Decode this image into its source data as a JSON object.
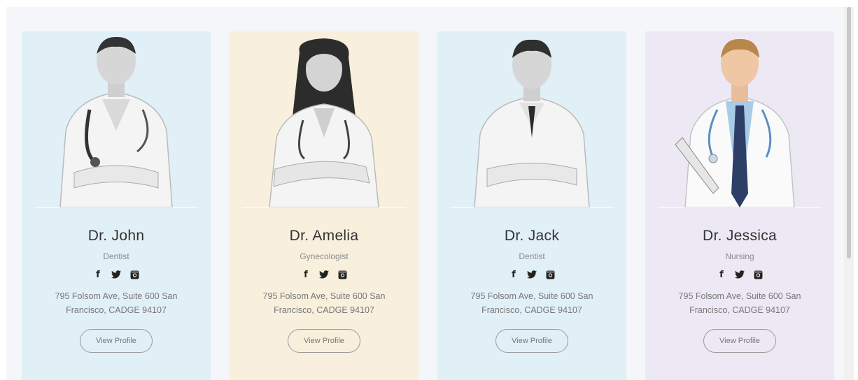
{
  "doctors": [
    {
      "name": "Dr. John",
      "role": "Dentist",
      "address": "795 Folsom Ave, Suite 600 San Francisco, CADGE 94107",
      "button": "View Profile",
      "card_color": "#e1eff7",
      "photo_style": "grayscale"
    },
    {
      "name": "Dr. Amelia",
      "role": "Gynecologist",
      "address": "795 Folsom Ave, Suite 600 San Francisco, CADGE 94107",
      "button": "View Profile",
      "card_color": "#f8f0dc",
      "photo_style": "grayscale"
    },
    {
      "name": "Dr. Jack",
      "role": "Dentist",
      "address": "795 Folsom Ave, Suite 600 San Francisco, CADGE 94107",
      "button": "View Profile",
      "card_color": "#e1eff7",
      "photo_style": "grayscale"
    },
    {
      "name": "Dr. Jessica",
      "role": "Nursing",
      "address": "795 Folsom Ave, Suite 600 San Francisco, CADGE 94107",
      "button": "View Profile",
      "card_color": "#ece9f4",
      "photo_style": "color"
    }
  ],
  "social_icons": [
    "facebook-icon",
    "twitter-icon",
    "instagram-icon"
  ],
  "social_glyphs": {
    "facebook": "f",
    "twitter": "🐦",
    "instagram": "◙"
  }
}
